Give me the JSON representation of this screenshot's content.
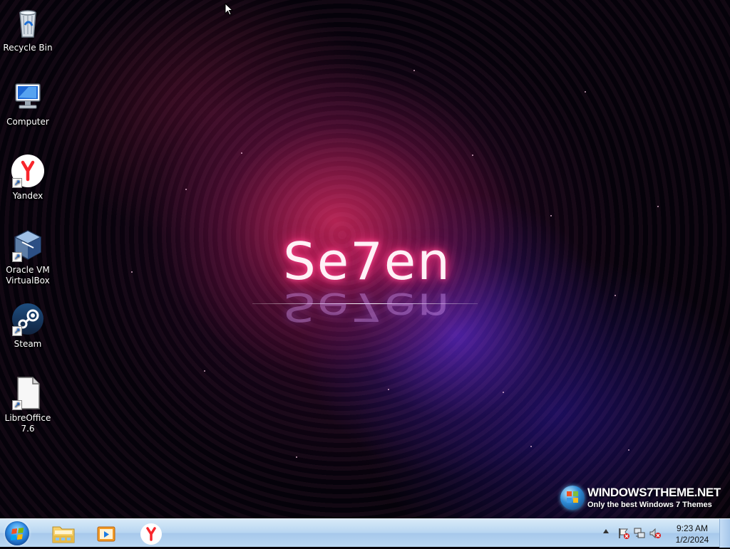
{
  "desktop": {
    "wallpaper": {
      "logo_text": "Se7en",
      "logo_reflection": "Se7en",
      "watermark": {
        "title": "WINDOWS7THEME.NET",
        "subtitle": "Only the best Windows 7 Themes"
      }
    },
    "icons": [
      {
        "label": "Recycle Bin",
        "icon": "recycle-bin-icon"
      },
      {
        "label": "Computer",
        "icon": "computer-icon"
      },
      {
        "label": "Yandex",
        "icon": "yandex-icon"
      },
      {
        "label": "Oracle VM VirtualBox",
        "icon": "virtualbox-icon"
      },
      {
        "label": "Steam",
        "icon": "steam-icon"
      },
      {
        "label": "LibreOffice 7.6",
        "icon": "libreoffice-icon"
      }
    ]
  },
  "taskbar": {
    "start_button": {
      "icon": "windows-start-orb-icon"
    },
    "pinned": [
      {
        "name": "Windows Explorer",
        "icon": "folder-explorer-icon"
      },
      {
        "name": "Windows Media Player",
        "icon": "media-player-icon"
      },
      {
        "name": "Yandex",
        "icon": "yandex-icon"
      }
    ],
    "tray": {
      "show_hidden": "chevron-up-icon",
      "icons": [
        "action-center-flag-icon",
        "network-icon",
        "volume-muted-icon"
      ],
      "time": "9:23 AM",
      "date": "1/2/2024"
    }
  },
  "colors": {
    "taskbar_top": "#d8eaf8",
    "taskbar_bottom": "#bad8f3",
    "logo_glow": "#ff2c76",
    "yandex_red": "#f8262c"
  }
}
